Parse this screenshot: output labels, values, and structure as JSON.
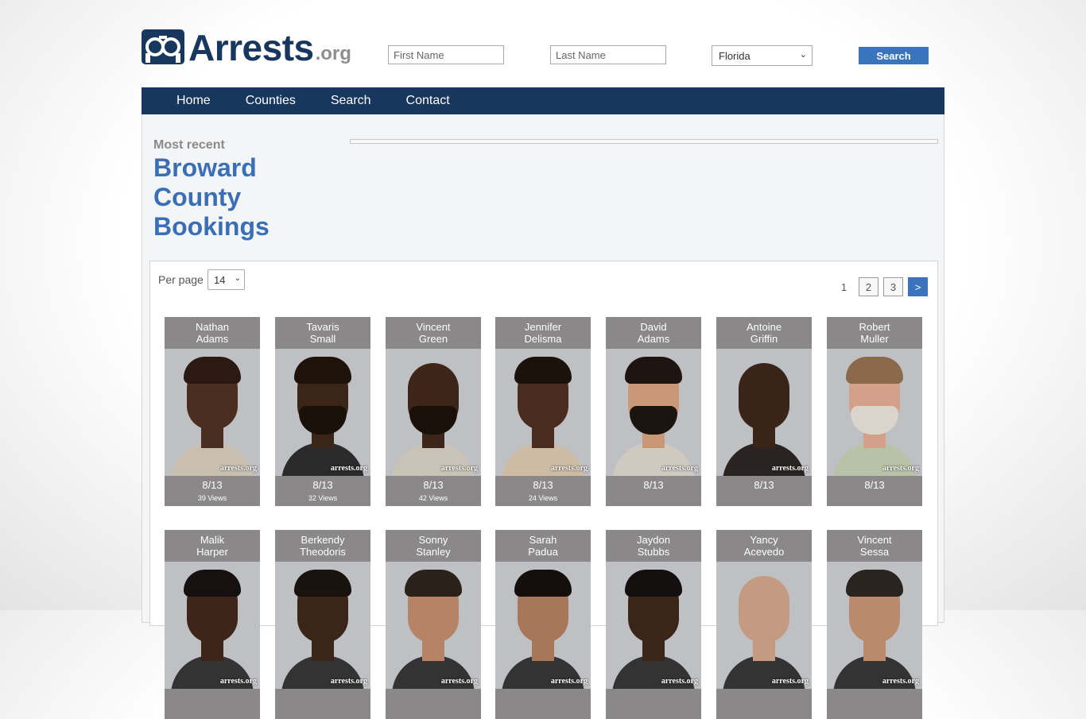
{
  "header": {
    "logo_text": "Arrests",
    "logo_suffix": ".org",
    "first_name_placeholder": "First Name",
    "last_name_placeholder": "Last Name",
    "state_selected": "Florida",
    "search_label": "Search"
  },
  "nav": [
    {
      "label": "Home"
    },
    {
      "label": "Counties"
    },
    {
      "label": "Search"
    },
    {
      "label": "Contact"
    }
  ],
  "main": {
    "kicker": "Most recent",
    "title": "Broward County Bookings",
    "per_page_label": "Per page",
    "per_page_value": "14",
    "pages": [
      "1",
      "2",
      "3",
      ">"
    ]
  },
  "bookings": [
    {
      "first": "Nathan",
      "last": "Adams",
      "date": "8/13",
      "views": "39 Views",
      "skin": "#4a2e22",
      "hair": "#2a1a12",
      "shirt": "#c9bfae",
      "beard": ""
    },
    {
      "first": "Tavaris",
      "last": "Small",
      "date": "8/13",
      "views": "32 Views",
      "skin": "#3b2418",
      "hair": "#1e120b",
      "shirt": "#2b2b2b",
      "beard": "#1a110b"
    },
    {
      "first": "Vincent",
      "last": "Green",
      "date": "8/13",
      "views": "42 Views",
      "skin": "#3e2519",
      "hair": "",
      "shirt": "#c8c3b6",
      "beard": "#1a100a"
    },
    {
      "first": "Jennifer",
      "last": "Delisma",
      "date": "8/13",
      "views": "24 Views",
      "skin": "#4a2c1f",
      "hair": "#1b120c",
      "shirt": "#cdbba3",
      "beard": ""
    },
    {
      "first": "David",
      "last": "Adams",
      "date": "8/13",
      "views": "",
      "skin": "#c99877",
      "hair": "#1e1510",
      "shirt": "#cfcac0",
      "beard": "#1c140f"
    },
    {
      "first": "Antoine",
      "last": "Griffin",
      "date": "8/13",
      "views": "",
      "skin": "#3a241a",
      "hair": "",
      "shirt": "#2b2321",
      "beard": ""
    },
    {
      "first": "Robert",
      "last": "Muller",
      "date": "8/13",
      "views": "",
      "skin": "#d3a08a",
      "hair": "#8a6a4a",
      "shirt": "#b7c2a6",
      "beard": "#d9d4cc"
    },
    {
      "first": "Malik",
      "last": "Harper",
      "date": "",
      "views": "",
      "skin": "#3d2519",
      "hair": "#161010",
      "shirt": "#333",
      "beard": ""
    },
    {
      "first": "Berkendy",
      "last": "Theodoris",
      "date": "",
      "views": "",
      "skin": "#3b2418",
      "hair": "#1a120d",
      "shirt": "#333",
      "beard": ""
    },
    {
      "first": "Sonny",
      "last": "Stanley",
      "date": "",
      "views": "",
      "skin": "#b58466",
      "hair": "#2a211b",
      "shirt": "#333",
      "beard": ""
    },
    {
      "first": "Sarah",
      "last": "Padua",
      "date": "",
      "views": "",
      "skin": "#a7775a",
      "hair": "#140f0c",
      "shirt": "#333",
      "beard": ""
    },
    {
      "first": "Jaydon",
      "last": "Stubbs",
      "date": "",
      "views": "",
      "skin": "#3b2418",
      "hair": "#141010",
      "shirt": "#333",
      "beard": ""
    },
    {
      "first": "Yancy",
      "last": "Acevedo",
      "date": "",
      "views": "",
      "skin": "#c49a80",
      "hair": "",
      "shirt": "#333",
      "beard": ""
    },
    {
      "first": "Vincent",
      "last": "Sessa",
      "date": "",
      "views": "",
      "skin": "#b98a6c",
      "hair": "#2a2420",
      "shirt": "#333",
      "beard": ""
    }
  ],
  "watermark": "arrests.org",
  "colors": {
    "brand": "#17375e",
    "accent": "#3a74bd",
    "title": "#3a6fb5",
    "card": "#8a8888"
  }
}
